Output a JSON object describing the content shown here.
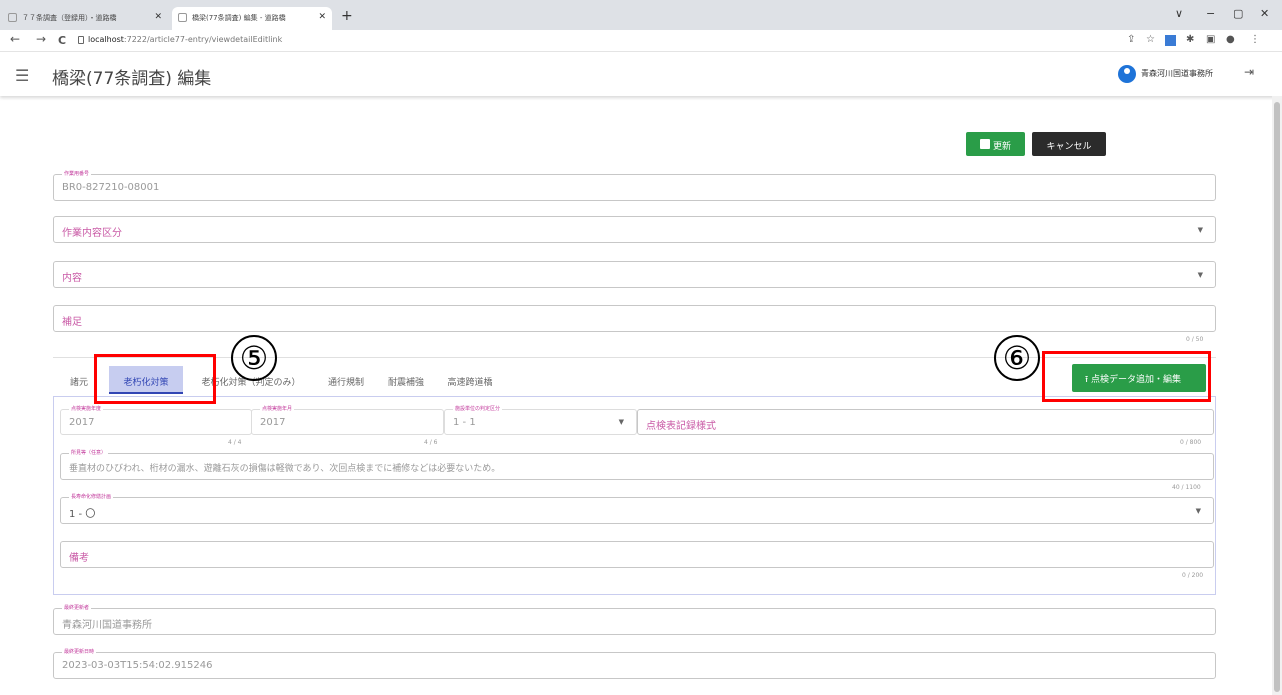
{
  "browser": {
    "tabs": [
      {
        "label": "７７条調査（登録用）・道路橋"
      },
      {
        "label": "橋梁(77条調査) 編集 - 道路橋"
      }
    ],
    "new_tab": "+",
    "controls": {
      "chevron": "∨",
      "minimize": "−",
      "maximize": "▢",
      "close": "✕"
    },
    "url_host": "localhost",
    "url_path": ":7222/article77-entry/viewdetailEditlink",
    "nav": {
      "back": "←",
      "forward": "→",
      "reload": "C"
    }
  },
  "header": {
    "menu_icon": "☰",
    "title": "橋梁(77条調査) 編集",
    "user": "青森河川国道事務所",
    "logout_icon": "⇥"
  },
  "actions": {
    "update_label": "更新",
    "cancel_label": "キャンセル"
  },
  "form": {
    "work_id": {
      "label": "作業用番号",
      "value": "BR0-827210-08001"
    },
    "work_type": {
      "placeholder": "作業内容区分"
    },
    "content": {
      "placeholder": "内容"
    },
    "note": {
      "placeholder": "補足",
      "counter": "0 / 50"
    }
  },
  "tabs": [
    {
      "label": "諸元"
    },
    {
      "label": "老朽化対策"
    },
    {
      "label": "老朽化対策（判定のみ）"
    },
    {
      "label": "通行規制"
    },
    {
      "label": "耐震補強"
    },
    {
      "label": "高速跨道橋"
    }
  ],
  "data_button_label": "点検データ追加・編集",
  "panel": {
    "year": {
      "label": "点検実施年度",
      "value": "2017",
      "counter": "4 / 4"
    },
    "month": {
      "label": "点検実施年月",
      "value": "2017",
      "counter": "4 / 6"
    },
    "judge": {
      "label": "施設単位の判定区分",
      "value": "1 - 1"
    },
    "record_style": {
      "placeholder": "点検表記録様式",
      "counter": "0 / 800"
    },
    "findings": {
      "label": "所見等（任意）",
      "value": "垂直材のひびわれ、桁材の漏水、遊離石灰の損傷は軽微であり、次回点検までに補修などは必要ないため。",
      "counter": "40 / 1100"
    },
    "measure": {
      "label": "長寿命化修繕計画",
      "value": "1 - 〇"
    },
    "remarks": {
      "placeholder": "備考",
      "counter": "0 / 200"
    }
  },
  "footer": {
    "updater": {
      "label": "最終更新者",
      "value": "青森河川国道事務所"
    },
    "updated_at": {
      "label": "最終更新日時",
      "value": "2023-03-03T15:54:02.915246"
    }
  },
  "callouts": [
    {
      "number": "⑤"
    },
    {
      "number": "⑥"
    }
  ]
}
